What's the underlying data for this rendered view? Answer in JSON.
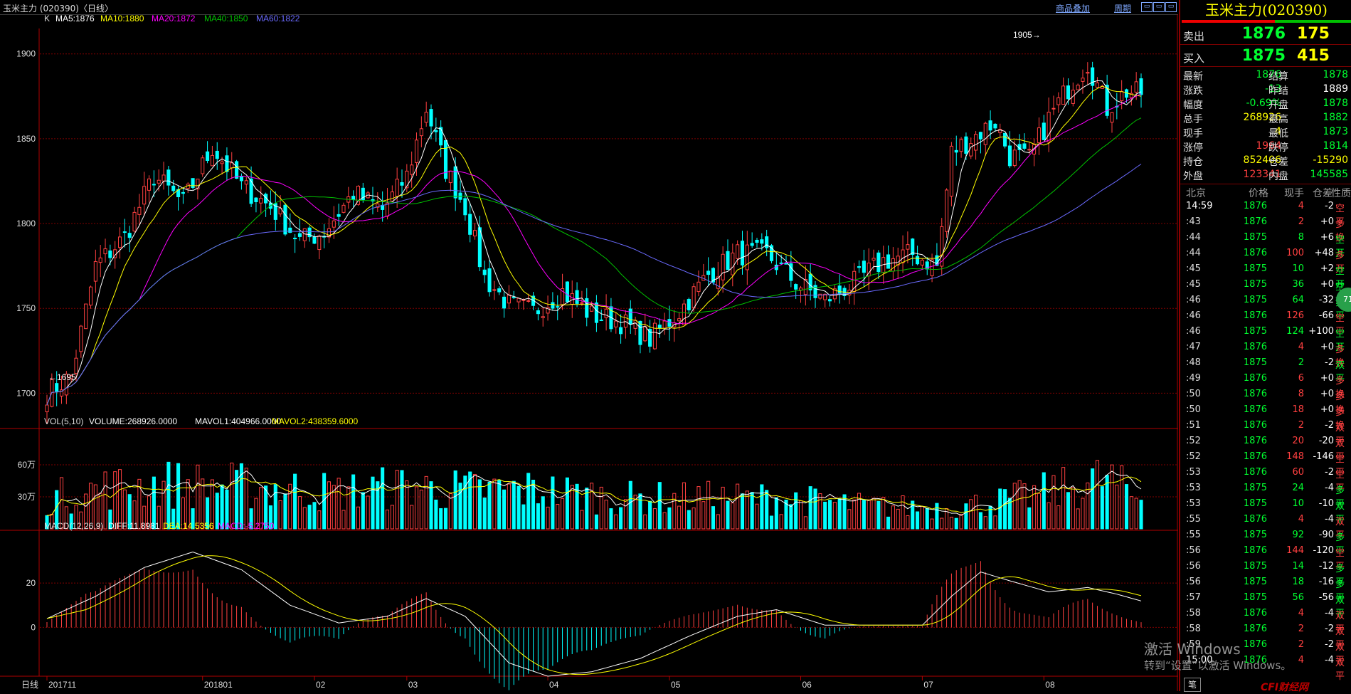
{
  "window": {
    "title": "玉米主力 (020390)〈日线〉",
    "link_overlay": "商品叠加",
    "link_period": "周期"
  },
  "main_panel": {
    "legend_label": "K",
    "ma5": "MA5:1876",
    "ma10": "MA10:1880",
    "ma20": "MA20:1872",
    "ma40": "MA40:1850",
    "ma60": "MA60:1822",
    "high_label": "1905→",
    "low_label": "←1695"
  },
  "vol_panel": {
    "label": "VOL(5,10)",
    "volume": "VOLUME:268926.0000",
    "mavol1": "MAVOL1:404966.0000",
    "mavol2": "MAVOL2:438359.6000"
  },
  "macd_panel": {
    "label": "MACD(12,26,9)",
    "diff": "DIFF:11.8981",
    "dea": "DEA:14.5356",
    "macd": "MACD:-5.2750"
  },
  "bottom_axis": {
    "period_label": "日线"
  },
  "colors": {
    "up": "#ff4040",
    "down": "#00ffff",
    "ma5": "#ffffff",
    "ma10": "#ffff00",
    "ma20": "#ff00ff",
    "ma40": "#00c000",
    "ma60": "#6a6aff",
    "grid": "#800000"
  },
  "quote": {
    "title": "玉米主力(020390)",
    "sell_label": "卖出",
    "sell_price": "1876",
    "sell_vol": "175",
    "buy_label": "买入",
    "buy_price": "1875",
    "buy_vol": "415"
  },
  "stats": [
    {
      "k1": "最新",
      "v1": "1876",
      "c1": "#00ff30",
      "k2": "结算",
      "v2": "1878",
      "c2": "#00ff30"
    },
    {
      "k1": "涨跌",
      "v1": "-13",
      "c1": "#00ff30",
      "k2": "昨结",
      "v2": "1889",
      "c2": "#ffffff"
    },
    {
      "k1": "幅度",
      "v1": "-0.69%",
      "c1": "#00ff30",
      "k2": "开盘",
      "v2": "1878",
      "c2": "#00ff30"
    },
    {
      "k1": "总手",
      "v1": "268926",
      "c1": "#ffff00",
      "k2": "最高",
      "v2": "1882",
      "c2": "#00ff30"
    },
    {
      "k1": "现手",
      "v1": "4",
      "c1": "#ffff00",
      "k2": "最低",
      "v2": "1873",
      "c2": "#00ff30"
    },
    {
      "k1": "涨停",
      "v1": "1964",
      "c1": "#ff4040",
      "k2": "跌停",
      "v2": "1814",
      "c2": "#00ff30"
    },
    {
      "k1": "持仓",
      "v1": "852406",
      "c1": "#ffff00",
      "k2": "仓差",
      "v2": "-15290",
      "c2": "#ffff00"
    },
    {
      "k1": "外盘",
      "v1": "123341",
      "c1": "#ff4040",
      "k2": "内盘",
      "v2": "145585",
      "c2": "#00ff30"
    }
  ],
  "tick_header": {
    "time": "北京",
    "price": "价格",
    "vol": "现手",
    "oi": "仓差",
    "nature": "性质"
  },
  "ticks": [
    {
      "t": "14:59",
      "p": "1876",
      "v": "4",
      "o": "-2",
      "n": "空平",
      "tc": "#ffffff",
      "nc": "#ff4040"
    },
    {
      "t": ":43",
      "p": "1876",
      "v": "2",
      "o": "+0",
      "n": "多换",
      "tc": "#ddd",
      "nc": "#ff4040"
    },
    {
      "t": ":44",
      "p": "1875",
      "v": "8",
      "o": "+6",
      "n": "空开",
      "tc": "#ddd",
      "nc": "#00ff30"
    },
    {
      "t": ":44",
      "p": "1876",
      "v": "100",
      "o": "+48",
      "n": "多开",
      "tc": "#ddd",
      "nc": "#ff4040"
    },
    {
      "t": ":45",
      "p": "1875",
      "v": "10",
      "o": "+2",
      "n": "空开",
      "tc": "#ddd",
      "nc": "#00ff30"
    },
    {
      "t": ":45",
      "p": "1875",
      "v": "36",
      "o": "+0",
      "n": "空换",
      "tc": "#ddd",
      "nc": "#00ff30"
    },
    {
      "t": ":46",
      "p": "1875",
      "v": "64",
      "o": "-32",
      "n": "多平",
      "tc": "#ddd",
      "nc": "#00ff30"
    },
    {
      "t": ":46",
      "p": "1876",
      "v": "126",
      "o": "-66",
      "n": "空平",
      "tc": "#ddd",
      "nc": "#ff4040"
    },
    {
      "t": ":46",
      "p": "1875",
      "v": "124",
      "o": "+100",
      "n": "空开",
      "tc": "#ddd",
      "nc": "#00ff30"
    },
    {
      "t": ":47",
      "p": "1876",
      "v": "4",
      "o": "+0",
      "n": "多换",
      "tc": "#ddd",
      "nc": "#ff4040"
    },
    {
      "t": ":48",
      "p": "1875",
      "v": "2",
      "o": "-2",
      "n": "双平",
      "tc": "#ddd",
      "nc": "#00ff30"
    },
    {
      "t": ":49",
      "p": "1876",
      "v": "6",
      "o": "+0",
      "n": "多换",
      "tc": "#ddd",
      "nc": "#ff4040"
    },
    {
      "t": ":50",
      "p": "1876",
      "v": "8",
      "o": "+0",
      "n": "多换",
      "tc": "#ddd",
      "nc": "#ff4040"
    },
    {
      "t": ":50",
      "p": "1876",
      "v": "18",
      "o": "+0",
      "n": "多换",
      "tc": "#ddd",
      "nc": "#ff4040"
    },
    {
      "t": ":51",
      "p": "1876",
      "v": "2",
      "o": "-2",
      "n": "双平",
      "tc": "#ddd",
      "nc": "#ff4040"
    },
    {
      "t": ":52",
      "p": "1876",
      "v": "20",
      "o": "-20",
      "n": "双平",
      "tc": "#ddd",
      "nc": "#ff4040"
    },
    {
      "t": ":52",
      "p": "1876",
      "v": "148",
      "o": "-146",
      "n": "空平",
      "tc": "#ddd",
      "nc": "#ff4040"
    },
    {
      "t": ":53",
      "p": "1876",
      "v": "60",
      "o": "-2",
      "n": "空平",
      "tc": "#ddd",
      "nc": "#ff4040"
    },
    {
      "t": ":53",
      "p": "1875",
      "v": "24",
      "o": "-4",
      "n": "多平",
      "tc": "#ddd",
      "nc": "#00ff30"
    },
    {
      "t": ":53",
      "p": "1875",
      "v": "10",
      "o": "-10",
      "n": "双平",
      "tc": "#ddd",
      "nc": "#00ff30"
    },
    {
      "t": ":55",
      "p": "1876",
      "v": "4",
      "o": "-4",
      "n": "双平",
      "tc": "#ddd",
      "nc": "#ff4040"
    },
    {
      "t": ":55",
      "p": "1875",
      "v": "92",
      "o": "-90",
      "n": "多平",
      "tc": "#ddd",
      "nc": "#00ff30"
    },
    {
      "t": ":56",
      "p": "1876",
      "v": "144",
      "o": "-120",
      "n": "空平",
      "tc": "#ddd",
      "nc": "#ff4040"
    },
    {
      "t": ":56",
      "p": "1875",
      "v": "14",
      "o": "-12",
      "n": "多平",
      "tc": "#ddd",
      "nc": "#00ff30"
    },
    {
      "t": ":56",
      "p": "1875",
      "v": "18",
      "o": "-16",
      "n": "多平",
      "tc": "#ddd",
      "nc": "#00ff30"
    },
    {
      "t": ":57",
      "p": "1875",
      "v": "56",
      "o": "-56",
      "n": "双平",
      "tc": "#ddd",
      "nc": "#00ff30"
    },
    {
      "t": ":58",
      "p": "1876",
      "v": "4",
      "o": "-4",
      "n": "双平",
      "tc": "#ddd",
      "nc": "#ff4040"
    },
    {
      "t": ":58",
      "p": "1876",
      "v": "2",
      "o": "-2",
      "n": "双平",
      "tc": "#ddd",
      "nc": "#ff4040"
    },
    {
      "t": ":59",
      "p": "1876",
      "v": "2",
      "o": "-2",
      "n": "双平",
      "tc": "#ddd",
      "nc": "#ff4040"
    },
    {
      "t": "15:00",
      "p": "1876",
      "v": "4",
      "o": "-4",
      "n": "双平",
      "tc": "#ffffff",
      "nc": "#ff4040"
    }
  ],
  "watermark": {
    "line1": "激活 Windows",
    "line2": "转到“设置”以激活 Windows。"
  },
  "badge_text": "71",
  "logo_text": "CFI财经网",
  "bottom_tab": "笔",
  "chart_data": [
    {
      "type": "candlestick",
      "title": "",
      "ylim": [
        1680,
        1915
      ],
      "yticks": [
        1700,
        1750,
        1800,
        1850,
        1900
      ],
      "ytick_labels": [
        "1700",
        "1750",
        "1800",
        "1850",
        "1900"
      ],
      "x_labels": [
        "201711",
        "201801",
        "02",
        "03",
        "04",
        "05",
        "06",
        "07",
        "08"
      ],
      "x_label_index": [
        0,
        32,
        55,
        74,
        103,
        128,
        155,
        180,
        205
      ],
      "keypoints": [
        {
          "i": 0,
          "v": 1700
        },
        {
          "i": 5,
          "v": 1710
        },
        {
          "i": 10,
          "v": 1775
        },
        {
          "i": 16,
          "v": 1792
        },
        {
          "i": 22,
          "v": 1828
        },
        {
          "i": 28,
          "v": 1812
        },
        {
          "i": 34,
          "v": 1845
        },
        {
          "i": 40,
          "v": 1822
        },
        {
          "i": 46,
          "v": 1810
        },
        {
          "i": 52,
          "v": 1790
        },
        {
          "i": 57,
          "v": 1795
        },
        {
          "i": 63,
          "v": 1818
        },
        {
          "i": 69,
          "v": 1808
        },
        {
          "i": 74,
          "v": 1828
        },
        {
          "i": 78,
          "v": 1868
        },
        {
          "i": 82,
          "v": 1832
        },
        {
          "i": 86,
          "v": 1810
        },
        {
          "i": 90,
          "v": 1768
        },
        {
          "i": 95,
          "v": 1752
        },
        {
          "i": 100,
          "v": 1748
        },
        {
          "i": 106,
          "v": 1760
        },
        {
          "i": 112,
          "v": 1746
        },
        {
          "i": 118,
          "v": 1742
        },
        {
          "i": 124,
          "v": 1732
        },
        {
          "i": 130,
          "v": 1748
        },
        {
          "i": 136,
          "v": 1770
        },
        {
          "i": 142,
          "v": 1782
        },
        {
          "i": 148,
          "v": 1782
        },
        {
          "i": 154,
          "v": 1765
        },
        {
          "i": 160,
          "v": 1755
        },
        {
          "i": 166,
          "v": 1765
        },
        {
          "i": 172,
          "v": 1778
        },
        {
          "i": 178,
          "v": 1782
        },
        {
          "i": 183,
          "v": 1775
        },
        {
          "i": 186,
          "v": 1842
        },
        {
          "i": 190,
          "v": 1850
        },
        {
          "i": 195,
          "v": 1860
        },
        {
          "i": 198,
          "v": 1840
        },
        {
          "i": 202,
          "v": 1838
        },
        {
          "i": 206,
          "v": 1862
        },
        {
          "i": 210,
          "v": 1880
        },
        {
          "i": 214,
          "v": 1895
        },
        {
          "i": 218,
          "v": 1868
        },
        {
          "i": 222,
          "v": 1878
        },
        {
          "i": 225,
          "v": 1876
        }
      ],
      "series": [
        {
          "name": "MA5",
          "last": 1876
        },
        {
          "name": "MA10",
          "last": 1880
        },
        {
          "name": "MA20",
          "last": 1872
        },
        {
          "name": "MA40",
          "last": 1850
        },
        {
          "name": "MA60",
          "last": 1822
        }
      ],
      "high": 1905,
      "low": 1695
    },
    {
      "type": "bar",
      "title": "",
      "ylim": [
        0,
        820000
      ],
      "yticks": [
        300000,
        600000
      ],
      "ytick_labels": [
        "30万",
        "60万"
      ],
      "keypoints": [
        {
          "i": 0,
          "v": 300000
        },
        {
          "i": 12,
          "v": 400000
        },
        {
          "i": 25,
          "v": 440000
        },
        {
          "i": 40,
          "v": 420000
        },
        {
          "i": 60,
          "v": 360000
        },
        {
          "i": 75,
          "v": 420000
        },
        {
          "i": 82,
          "v": 380000
        },
        {
          "i": 100,
          "v": 380000
        },
        {
          "i": 120,
          "v": 300000
        },
        {
          "i": 150,
          "v": 300000
        },
        {
          "i": 170,
          "v": 220000
        },
        {
          "i": 185,
          "v": 210000
        },
        {
          "i": 195,
          "v": 260000
        },
        {
          "i": 210,
          "v": 400000
        },
        {
          "i": 218,
          "v": 500000
        },
        {
          "i": 225,
          "v": 268926
        }
      ],
      "last": 268926
    },
    {
      "type": "bar",
      "title": "",
      "ylim": [
        -22,
        38
      ],
      "yticks": [
        0,
        20
      ],
      "ytick_labels": [
        "0",
        "20"
      ],
      "diff_keypoints": [
        {
          "i": 0,
          "v": 4
        },
        {
          "i": 10,
          "v": 14
        },
        {
          "i": 20,
          "v": 27
        },
        {
          "i": 30,
          "v": 34
        },
        {
          "i": 40,
          "v": 26
        },
        {
          "i": 50,
          "v": 10
        },
        {
          "i": 60,
          "v": 2
        },
        {
          "i": 70,
          "v": 5
        },
        {
          "i": 78,
          "v": 13
        },
        {
          "i": 86,
          "v": 5
        },
        {
          "i": 95,
          "v": -16
        },
        {
          "i": 103,
          "v": -22
        },
        {
          "i": 112,
          "v": -20
        },
        {
          "i": 122,
          "v": -14
        },
        {
          "i": 132,
          "v": -4
        },
        {
          "i": 142,
          "v": 5
        },
        {
          "i": 150,
          "v": 8
        },
        {
          "i": 160,
          "v": 1
        },
        {
          "i": 170,
          "v": 1
        },
        {
          "i": 180,
          "v": 1
        },
        {
          "i": 186,
          "v": 14
        },
        {
          "i": 192,
          "v": 25
        },
        {
          "i": 198,
          "v": 21
        },
        {
          "i": 206,
          "v": 16
        },
        {
          "i": 214,
          "v": 18
        },
        {
          "i": 220,
          "v": 15
        },
        {
          "i": 225,
          "v": 11.9
        }
      ],
      "series": [
        {
          "name": "DIFF",
          "last": 11.8981
        },
        {
          "name": "DEA",
          "last": 14.5356
        },
        {
          "name": "MACD",
          "last": -5.275
        }
      ]
    }
  ]
}
